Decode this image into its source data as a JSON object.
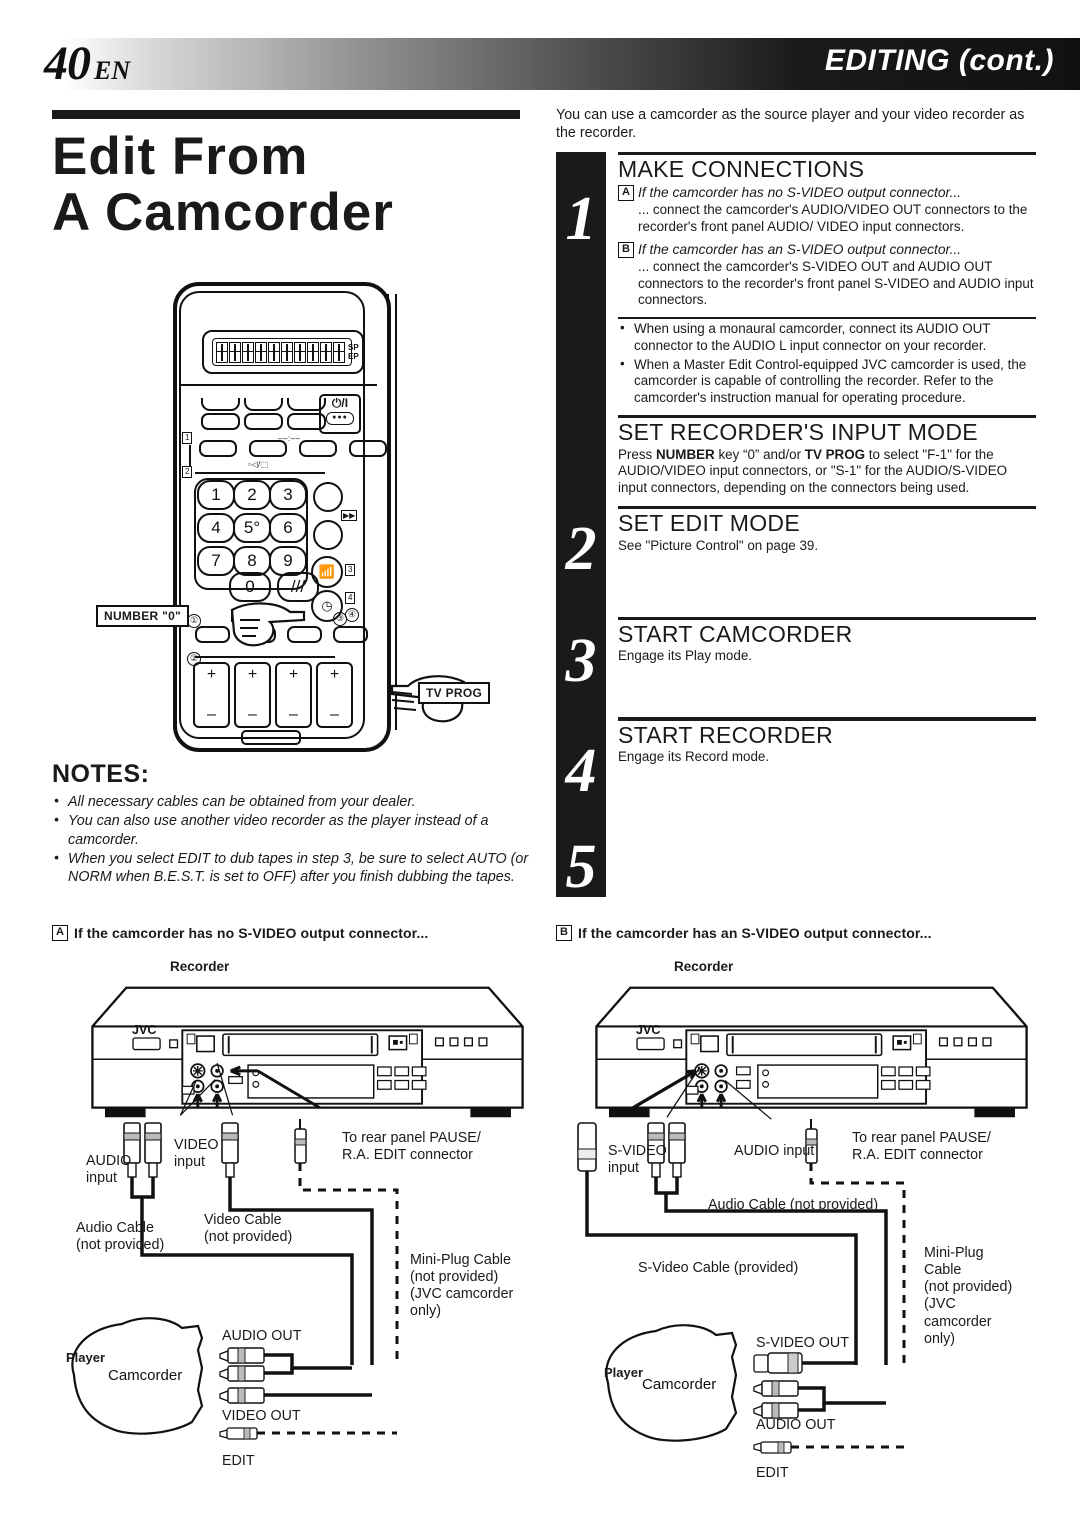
{
  "header": {
    "page_number": "40",
    "lang": "EN",
    "title": "EDITING (cont.)"
  },
  "left": {
    "title_line1": "Edit From",
    "title_line2": "A Camcorder",
    "remote": {
      "lcd_sp": "SP",
      "lcd_ep": "EP",
      "power_symbol": "⏻/I",
      "power_dots": "●●●",
      "keys": [
        "1",
        "2",
        "3",
        "4",
        "5°",
        "6",
        "7",
        "8",
        "9"
      ],
      "key_zero": "0",
      "mark_1": "1",
      "mark_2": "2",
      "mark_3": "3",
      "mark_4": "4",
      "circle_1": "①",
      "circle_2": "②",
      "circle_3": "③",
      "circle_4": "④",
      "volume_label": "▫◁/⬚",
      "timer_label": "––:––",
      "help_label": "⦿ ?",
      "ffw_label": "▶▶",
      "plus": "+",
      "minus": "–"
    },
    "callouts": {
      "number_zero": "NUMBER \"0\"",
      "tv_prog": "TV PROG"
    },
    "notes": {
      "heading": "NOTES:",
      "items": [
        "All necessary cables can be obtained from your dealer.",
        "You can also use another video recorder as the player instead of a camcorder.",
        "When you select EDIT to dub tapes in step 3, be sure to select AUTO (or NORM when B.E.S.T. is set to OFF) after you finish dubbing the tapes."
      ]
    }
  },
  "right": {
    "intro": "You can use a camcorder as the source player and your video recorder as the recorder.",
    "steps": [
      {
        "number": "1",
        "heading": "MAKE CONNECTIONS",
        "a_label": "A",
        "a_italic": "If the camcorder has no S-VIDEO output connector...",
        "a_body": "... connect the camcorder's AUDIO/VIDEO OUT connectors to the recorder's front panel AUDIO/ VIDEO input connectors.",
        "b_label": "B",
        "b_italic": "If the camcorder has an S-VIDEO output connector...",
        "b_body": "... connect the camcorder's S-VIDEO OUT and AUDIO OUT connectors to the recorder's front panel S-VIDEO and AUDIO input connectors.",
        "bullets": [
          "When using a monaural camcorder, connect its AUDIO OUT connector to the AUDIO L input connector on your recorder.",
          "When a Master Edit Control-equipped JVC camcorder is used, the camcorder is capable of controlling the recorder. Refer to the camcorder's instruction manual for operating procedure."
        ]
      },
      {
        "number": "2",
        "heading": "SET RECORDER'S INPUT MODE",
        "body_pre": "Press ",
        "body_b1": "NUMBER",
        "body_mid": " key “0” and/or ",
        "body_b2": "TV PROG",
        "body_post": " to select \"F-1\" for the AUDIO/VIDEO input connectors, or \"S-1\" for the AUDIO/S-VIDEO input connectors, depending on the connectors being used."
      },
      {
        "number": "3",
        "heading": "SET EDIT MODE",
        "body": "See \"Picture Control\" on page 39."
      },
      {
        "number": "4",
        "heading": "START CAMCORDER",
        "body": "Engage its Play mode."
      },
      {
        "number": "5",
        "heading": "START RECORDER",
        "body": "Engage its Record mode."
      }
    ]
  },
  "diagram_a": {
    "box_label": "A",
    "caption": "If the camcorder has no S-VIDEO output connector...",
    "recorder_label": "Recorder",
    "brand": "JVC",
    "audio_input": "AUDIO\ninput",
    "video_input": "VIDEO\ninput",
    "pause_edit": "To rear panel PAUSE/\nR.A. EDIT connector",
    "audio_cable": "Audio Cable\n(not provided)",
    "video_cable": "Video Cable\n(not provided)",
    "miniplug_cable": "Mini-Plug Cable\n(not provided)\n(JVC camcorder\nonly)",
    "player_label": "Player",
    "camcorder_label": "Camcorder",
    "audio_out": "AUDIO OUT",
    "video_out": "VIDEO OUT",
    "edit": "EDIT"
  },
  "diagram_b": {
    "box_label": "B",
    "caption": "If the camcorder has an S-VIDEO output connector...",
    "recorder_label": "Recorder",
    "brand": "JVC",
    "svideo_input": "S-VIDEO\ninput",
    "audio_input": "AUDIO input",
    "pause_edit": "To rear panel PAUSE/\nR.A. EDIT connector",
    "audio_cable": "Audio Cable (not provided)",
    "svideo_cable": "S-Video Cable (provided)",
    "miniplug_cable": "Mini-Plug\nCable\n(not provided)\n(JVC\ncamcorder\nonly)",
    "player_label": "Player",
    "camcorder_label": "Camcorder",
    "svideo_out": "S-VIDEO OUT",
    "audio_out": "AUDIO OUT",
    "edit": "EDIT"
  },
  "colors": {
    "ink": "#1a1a1a",
    "paper": "#ffffff"
  }
}
